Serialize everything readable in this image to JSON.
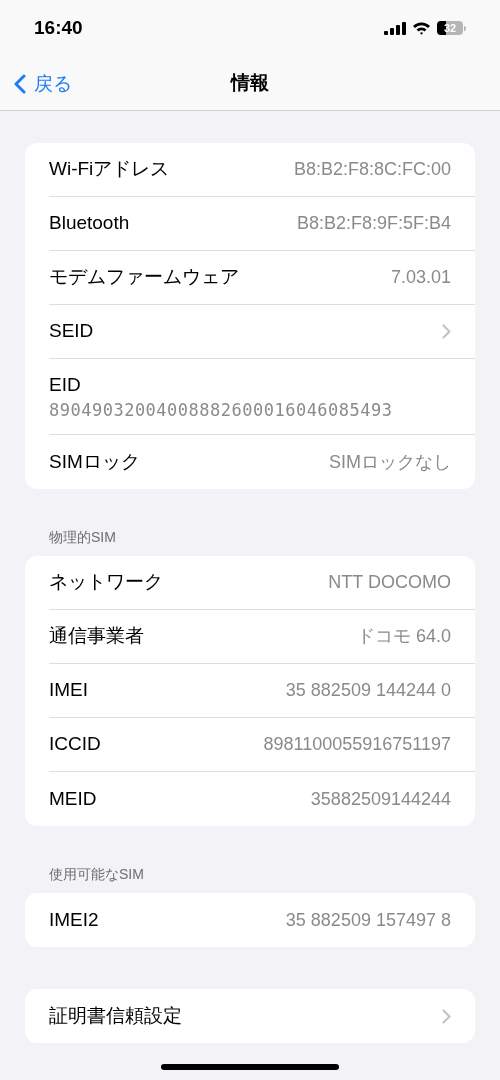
{
  "status_bar": {
    "time": "16:40",
    "battery": "32"
  },
  "nav": {
    "back": "戻る",
    "title": "情報"
  },
  "sections": [
    {
      "rows": [
        {
          "kind": "value",
          "label": "Wi-Fiアドレス",
          "value": "B8:B2:F8:8C:FC:00"
        },
        {
          "kind": "value",
          "label": "Bluetooth",
          "value": "B8:B2:F8:9F:5F:B4"
        },
        {
          "kind": "value",
          "label": "モデムファームウェア",
          "value": "7.03.01"
        },
        {
          "kind": "link",
          "label": "SEID"
        },
        {
          "kind": "stacked",
          "label": "EID",
          "value": "89049032004008882600016046085493"
        },
        {
          "kind": "value",
          "label": "SIMロック",
          "value": "SIMロックなし"
        }
      ]
    },
    {
      "header": "物理的SIM",
      "rows": [
        {
          "kind": "value",
          "label": "ネットワーク",
          "value": "NTT DOCOMO"
        },
        {
          "kind": "value",
          "label": "通信事業者",
          "value": "ドコモ 64.0"
        },
        {
          "kind": "value",
          "label": "IMEI",
          "value": "35 882509 144244 0"
        },
        {
          "kind": "value",
          "label": "ICCID",
          "value": "8981100055916751197"
        },
        {
          "kind": "value",
          "label": "MEID",
          "value": "35882509144244"
        }
      ]
    },
    {
      "header": "使用可能なSIM",
      "rows": [
        {
          "kind": "value",
          "label": "IMEI2",
          "value": "35 882509 157497 8"
        }
      ]
    },
    {
      "rows": [
        {
          "kind": "link",
          "label": "証明書信頼設定"
        }
      ]
    }
  ]
}
